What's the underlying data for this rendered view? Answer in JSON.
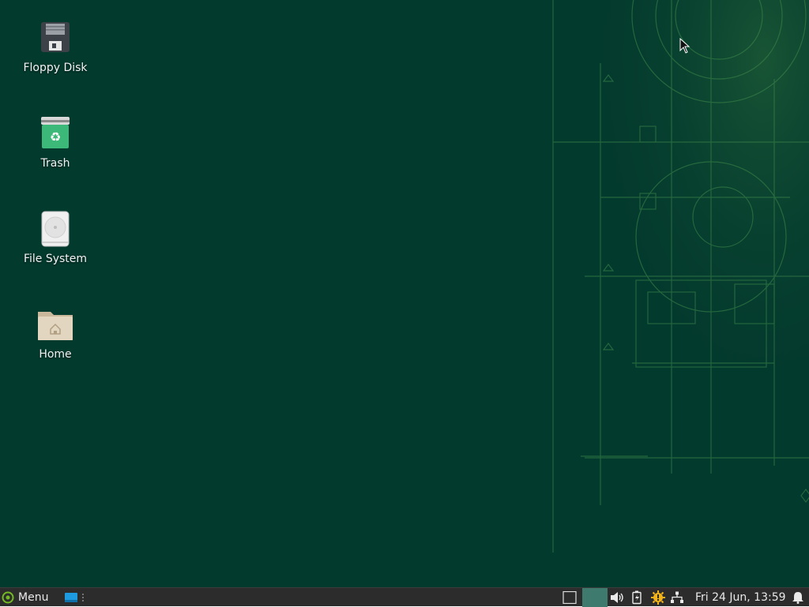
{
  "desktop": {
    "background_color": "#033a2e",
    "icons": [
      {
        "label": "Floppy Disk",
        "icon": "floppy-disk-icon"
      },
      {
        "label": "Trash",
        "icon": "trash-icon"
      },
      {
        "label": "File System",
        "icon": "hard-drive-icon"
      },
      {
        "label": "Home",
        "icon": "home-folder-icon"
      }
    ]
  },
  "taskbar": {
    "menu_label": "Menu",
    "clock": "Fri 24 Jun, 13:59",
    "background_color": "#2c2c2c",
    "workspace_color": "#3e7a6e",
    "tray_icons": [
      "volume-icon",
      "battery-icon",
      "updates-icon",
      "network-icon",
      "notifications-icon"
    ]
  }
}
